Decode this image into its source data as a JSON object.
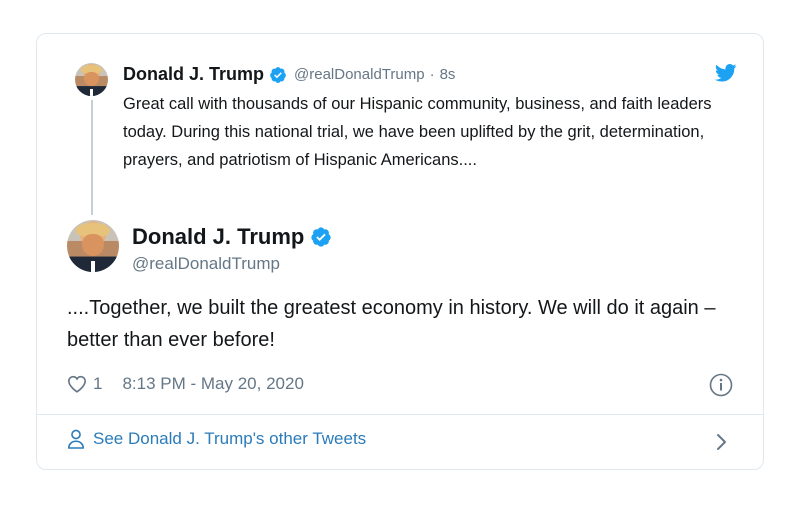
{
  "quoted_tweet": {
    "author_name": "Donald J. Trump",
    "handle": "@realDonaldTrump",
    "time": "8s",
    "text": "Great call with thousands of our Hispanic community, business, and faith leaders today. During this national trial, we have been uplifted by the grit, determination, prayers, and patriotism of Hispanic Americans....",
    "icons": [
      "avatar",
      "verified-icon",
      "twitter-bird-icon"
    ]
  },
  "main_tweet": {
    "author_name": "Donald J. Trump",
    "handle": "@realDonaldTrump",
    "text": "....Together, we built the greatest economy in history. We will do it again – better than ever before!",
    "like_count": "1",
    "timestamp": "8:13 PM - May 20, 2020",
    "icons": [
      "avatar",
      "verified-icon",
      "heart-icon",
      "info-icon"
    ]
  },
  "footer": {
    "link_text": "See Donald J. Trump's other Tweets",
    "icons": [
      "person-icon",
      "chevron-right-icon"
    ]
  },
  "colors": {
    "link_blue": "#2b7bb9",
    "verified_blue": "#1da1f2",
    "secondary_text": "#657786",
    "border": "#e1e8ed"
  }
}
